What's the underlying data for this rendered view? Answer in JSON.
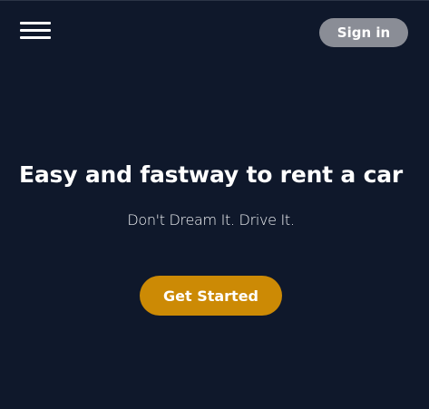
{
  "header": {
    "menu_icon": "hamburger-menu-icon",
    "signin_label": "Sign in"
  },
  "hero": {
    "title": "Easy and fastway to rent a car",
    "subtitle": "Don't Dream It. Drive It.",
    "cta_label": "Get Started"
  },
  "colors": {
    "background": "#0f182b",
    "signin_bg": "#8a8d96",
    "cta_bg": "#cc8a05",
    "text": "#ffffff"
  }
}
